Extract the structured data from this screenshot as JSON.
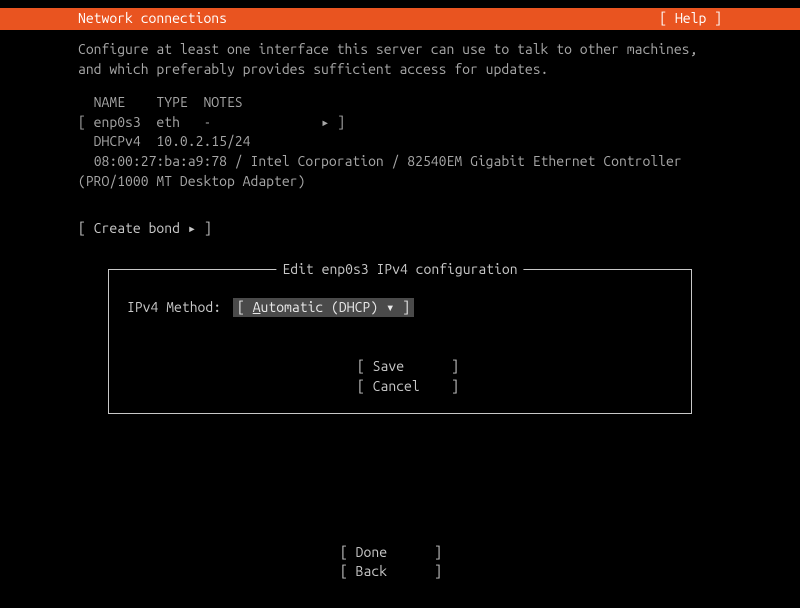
{
  "header": {
    "title": "Network connections",
    "help": "[ Help ]"
  },
  "description": "Configure at least one interface this server can use to talk to other machines, and which preferably provides sufficient access for updates.",
  "table": {
    "headers": "  NAME    TYPE  NOTES",
    "row": "[ enp0s3  eth   -              ▸ ]",
    "dhcp": "  DHCPv4  10.0.2.15/24",
    "hw": "  08:00:27:ba:a9:78 / Intel Corporation / 82540EM Gigabit Ethernet Controller (PRO/1000 MT Desktop Adapter)"
  },
  "create_bond": "[ Create bond ▸ ]",
  "dialog": {
    "title": " Edit enp0s3 IPv4 configuration ",
    "field_label": "IPv4 Method:",
    "dropdown_open": "[ ",
    "dropdown_underline_char": "A",
    "dropdown_rest": "utomatic (DHCP) ▾ ]",
    "save": "[ Save      ]",
    "cancel": "[ Cancel    ]"
  },
  "footer": {
    "done": "[ Done      ]",
    "back": "[ Back      ]"
  }
}
